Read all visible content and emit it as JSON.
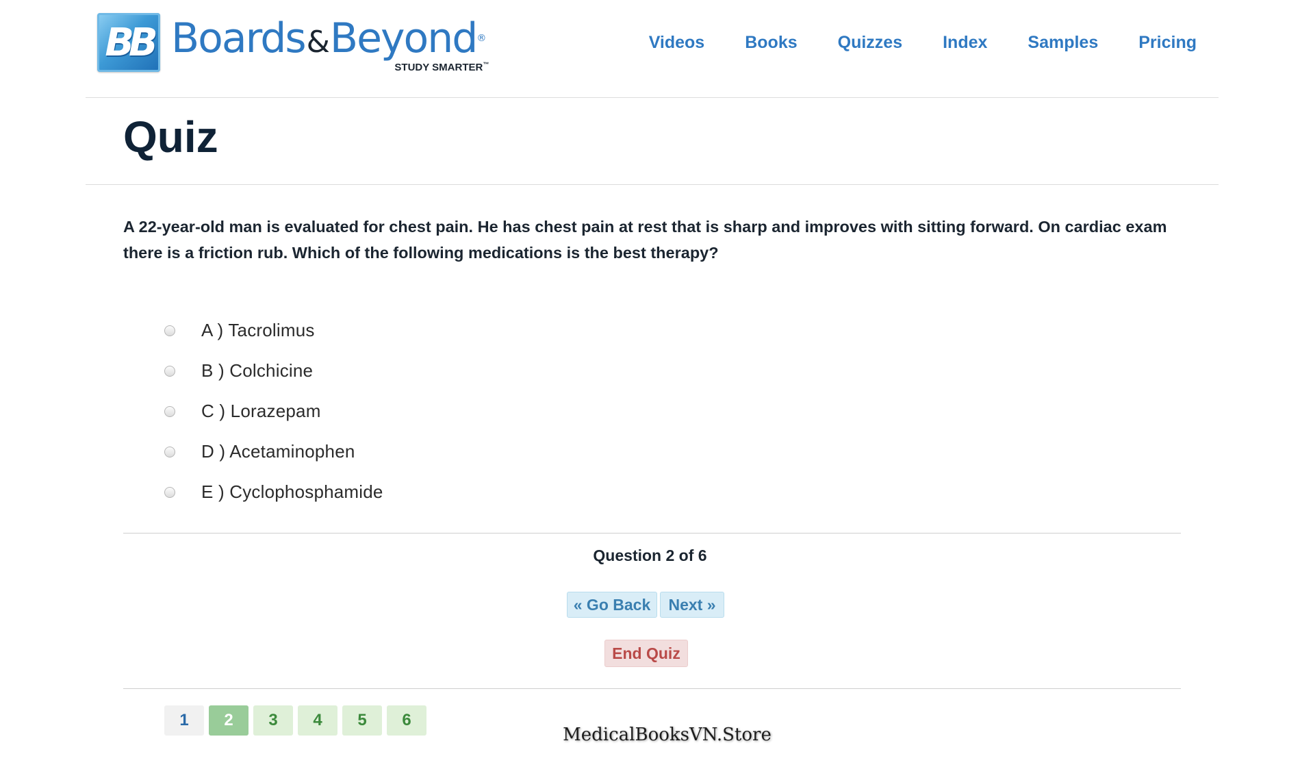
{
  "header": {
    "logo_badge": "BB",
    "logo_word1": "Boards",
    "logo_amp": "&",
    "logo_word2": "Beyond",
    "logo_reg": "®",
    "logo_tagline": "STUDY SMARTER",
    "logo_tm": "™",
    "nav": [
      {
        "label": "Videos"
      },
      {
        "label": "Books"
      },
      {
        "label": "Quizzes"
      },
      {
        "label": "Index"
      },
      {
        "label": "Samples"
      },
      {
        "label": "Pricing"
      }
    ]
  },
  "page_title": "Quiz",
  "question": {
    "text": "A 22-year-old man is evaluated for chest pain. He has chest pain at rest that is sharp and improves with sitting forward. On cardiac exam there is a friction rub. Which of the following medications is the best therapy?",
    "answers": [
      {
        "label": "A ) Tacrolimus",
        "selected": false
      },
      {
        "label": "B ) Colchicine",
        "selected": false
      },
      {
        "label": "C ) Lorazepam",
        "selected": false
      },
      {
        "label": "D ) Acetaminophen",
        "selected": false
      },
      {
        "label": "E ) Cyclophosphamide",
        "selected": false
      }
    ]
  },
  "progress": {
    "text": "Question 2 of 6",
    "current": 2,
    "total": 6
  },
  "buttons": {
    "back": "« Go Back",
    "next": "Next »",
    "end": "End Quiz"
  },
  "pager": [
    {
      "label": "1",
      "state": "normal"
    },
    {
      "label": "2",
      "state": "current"
    },
    {
      "label": "3",
      "state": "green"
    },
    {
      "label": "4",
      "state": "green"
    },
    {
      "label": "5",
      "state": "green"
    },
    {
      "label": "6",
      "state": "green"
    }
  ],
  "watermark": "MedicalBooksVN.Store",
  "colors": {
    "brand_blue": "#2f79c2",
    "title_navy": "#0f2236",
    "btn_blue_bg": "#d9edf7",
    "btn_red_bg": "#f2dede",
    "btn_red_text": "#b94a48",
    "pager_current": "#99cc99",
    "pager_green": "#dff0d8"
  }
}
